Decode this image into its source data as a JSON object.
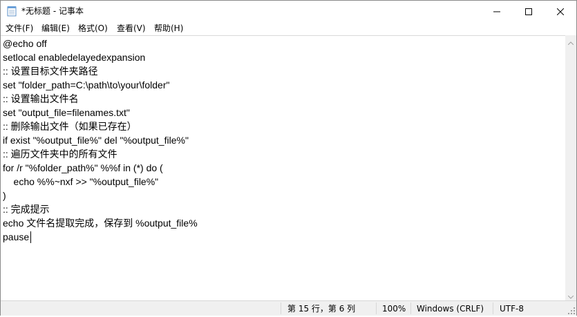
{
  "window": {
    "title": "*无标题 - 记事本"
  },
  "icons": {
    "app": "notepad-icon",
    "minimize": "minimize-icon",
    "maximize": "maximize-icon",
    "close": "close-icon",
    "scroll_up": "chevron-up-icon",
    "scroll_down": "chevron-down-icon",
    "grip": "resize-grip-icon"
  },
  "menu": {
    "file": "文件(F)",
    "edit": "编辑(E)",
    "format": "格式(O)",
    "view": "查看(V)",
    "help": "帮助(H)"
  },
  "editor": {
    "lines": [
      "@echo off",
      "setlocal enabledelayedexpansion",
      ":: 设置目标文件夹路径",
      "set \"folder_path=C:\\path\\to\\your\\folder\"",
      ":: 设置输出文件名",
      "set \"output_file=filenames.txt\"",
      ":: 删除输出文件（如果已存在）",
      "if exist \"%output_file%\" del \"%output_file%\"",
      ":: 遍历文件夹中的所有文件",
      "for /r \"%folder_path%\" %%f in (*) do (",
      "    echo %%~nxf >> \"%output_file%\"",
      ")",
      ":: 完成提示",
      "echo 文件名提取完成，保存到 %output_file%",
      "pause"
    ]
  },
  "status": {
    "position": "第 15 行，第 6 列",
    "zoom": "100%",
    "line_ending": "Windows (CRLF)",
    "encoding": "UTF-8"
  }
}
